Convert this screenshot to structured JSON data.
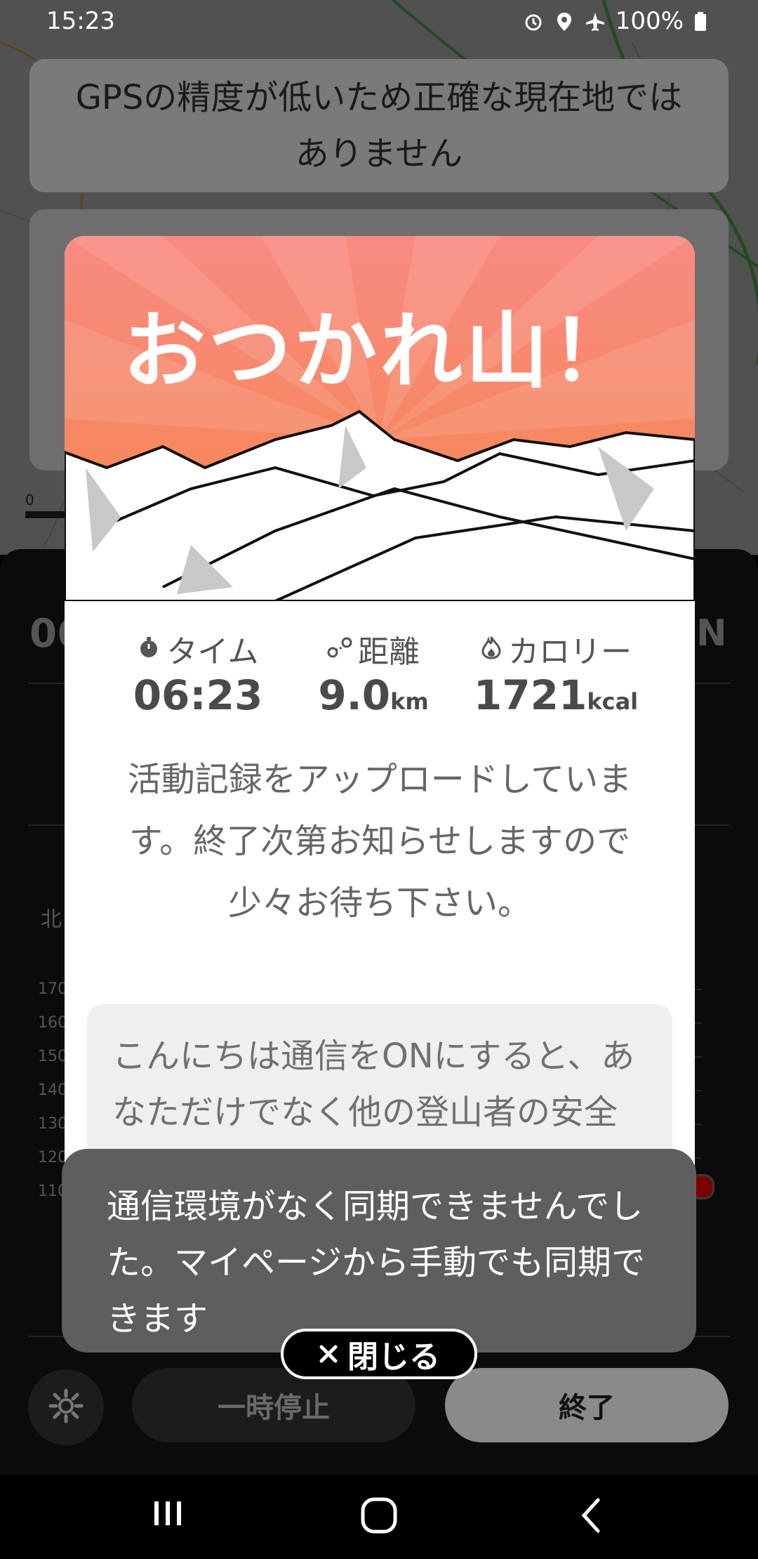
{
  "status_bar": {
    "time": "15:23",
    "battery": "100%",
    "icons": [
      "alarm-icon",
      "location-icon",
      "airplane-icon",
      "battery-icon"
    ]
  },
  "gps_banner": {
    "message": "GPSの精度が低いため正確な現在地ではありません"
  },
  "map": {
    "scale_label": "0"
  },
  "tracking_panel": {
    "time_partial": "06",
    "north_label": "N",
    "direction_label": "北",
    "y_axis_labels": [
      "170",
      "160",
      "150",
      "140",
      "130",
      "120",
      "110"
    ]
  },
  "modal": {
    "title": "おつかれ山！",
    "stats": [
      {
        "icon": "stopwatch-icon",
        "label": "タイム",
        "value": "06:23",
        "unit": ""
      },
      {
        "icon": "distance-icon",
        "label": "距離",
        "value": "9.0",
        "unit": "km"
      },
      {
        "icon": "flame-icon",
        "label": "カロリー",
        "value": "1721",
        "unit": "kcal"
      }
    ],
    "message": "活動記録をアップロードしています。終了次第お知らせしますので少々お待ち下さい。",
    "info": "こんにちは通信をONにすると、あなただけでなく他の登山者の安全にもつながります。次回はぜひご利用ください。",
    "close_label": "閉じる"
  },
  "toast": {
    "message": "通信環境がなく同期できませんでした。マイページから手動でも同期できます"
  },
  "controls": {
    "pause_label": "一時停止",
    "end_label": "終了"
  },
  "colors": {
    "header_top": "#f98a82",
    "header_bottom": "#f5874a",
    "toast_bg": "#5e5e5e"
  }
}
